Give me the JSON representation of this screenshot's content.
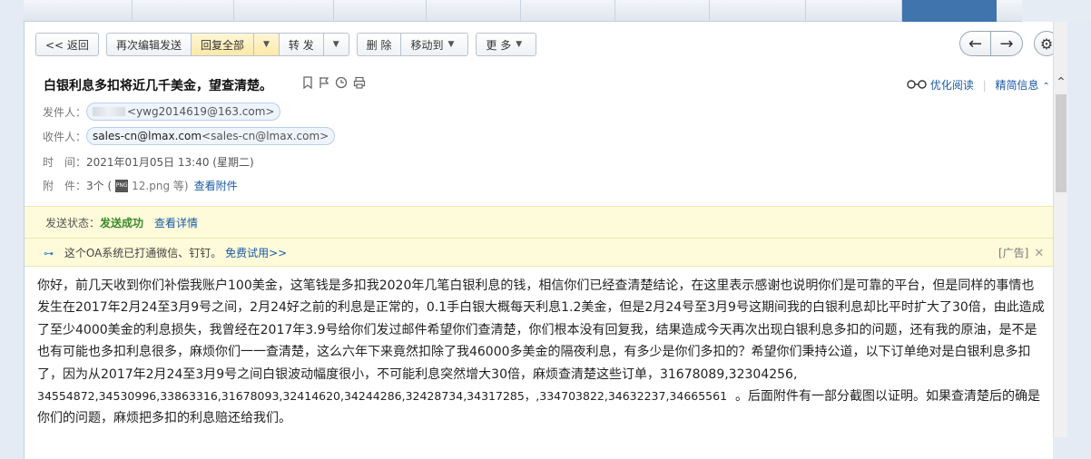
{
  "toolbar": {
    "back": "<< 返回",
    "reedit_send": "再次编辑发送",
    "reply_all": "回复全部",
    "forward": "转 发",
    "delete": "删 除",
    "move_to": "移动到",
    "more": "更 多"
  },
  "nav": {
    "prev_icon": "←",
    "next_icon": "→",
    "settings_icon": "⚙"
  },
  "email": {
    "subject": "白银利息多扣将近几千美金，望查清楚。",
    "subject_icons": [
      "bookmark-icon",
      "flag-icon",
      "clock-icon",
      "print-icon"
    ],
    "read_mode": "优化阅读",
    "compact_info": "精简信息",
    "from_label": "发件人：",
    "from_email": "<ywg2014619@163.com>",
    "to_label": "收件人：",
    "to_name": "sales-cn@lmax.com",
    "to_email": "<sales-cn@lmax.com>",
    "time_label": "时　间：",
    "time_value": "2021年01月05日 13:40 (星期二)",
    "attach_label": "附　件：",
    "attach_count": "3个 (",
    "attach_file": "12.png 等)",
    "attach_view": "查看附件"
  },
  "status": {
    "label": "发送状态：",
    "value": "发送成功",
    "details": "查看详情"
  },
  "oa": {
    "text": "这个OA系统已打通微信、钉钉。",
    "link": "免费试用>>",
    "ad": "[广告]",
    "close": "✕"
  },
  "body": {
    "paragraph1": "你好，前几天收到你们补偿我账户100美金，这笔钱是多扣我2020年几笔白银利息的钱，相信你们已经查清楚结论，在这里表示感谢也说明你们是可靠的平台，但是同样的事情也发生在2017年2月24至3月9号之间，2月24好之前的利息是正常的，0.1手白银大概每天利息1.2美金，但是2月24号至3月9号这期间我的白银利息却比平时扩大了30倍，由此造成了至少4000美金的利息损失，我曾经在2017年3.9号给你们发过邮件希望你们查清楚，你们根本没有回复我，结果造成今天再次出现白银利息多扣的问题，还有我的原油，是不是也有可能也多扣利息很多，麻烦你们一一查清楚，这么六年下来竟然扣除了我46000多美金的隔夜利息，有多少是你们多扣的？希望你们秉持公道，以下订单绝对是白银利息多扣了，因为从2017年2月24至3月9号之间白银波动幅度很小，不可能利息突然增大30倍，麻烦查清楚这些订单，31678089,32304256,",
    "orders_line": "34554872,34530996,33863316,31678093,32414620,34244286,32428734,34317285，,334703822,34632237,34665561",
    "paragraph1_tail": "。后面附件有一部分截图以证明。如果查清楚后的确是你们的问题，麻烦把多扣的利息赔还给我们。"
  }
}
